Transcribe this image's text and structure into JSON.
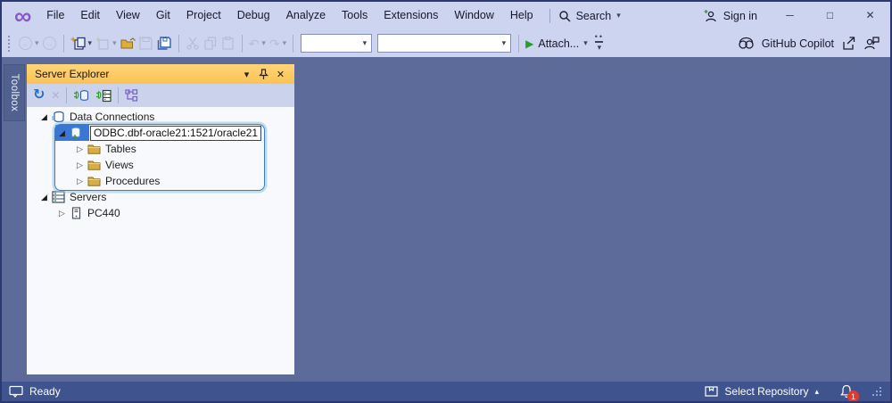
{
  "titlebar": {
    "menus": [
      "File",
      "Edit",
      "View",
      "Git",
      "Project",
      "Debug",
      "Analyze",
      "Tools",
      "Extensions",
      "Window",
      "Help"
    ],
    "search_label": "Search",
    "sign_in_label": "Sign in"
  },
  "toolbar": {
    "attach_label": "Attach...",
    "copilot_label": "GitHub Copilot"
  },
  "left_dock": {
    "toolbox_label": "Toolbox"
  },
  "server_explorer": {
    "title": "Server Explorer",
    "tree": [
      {
        "label": "Data Connections"
      },
      {
        "label": "ODBC.dbf-oracle21:1521/oracle21"
      },
      {
        "label": "Tables"
      },
      {
        "label": "Views"
      },
      {
        "label": "Procedures"
      },
      {
        "label": "Servers"
      },
      {
        "label": "PC440"
      }
    ]
  },
  "statusbar": {
    "ready_label": "Ready",
    "select_repository_label": "Select Repository",
    "notification_count": "1"
  },
  "icons": {
    "vs_logo": "∞",
    "back": "←",
    "forward": "→",
    "undo": "↶",
    "redo": "↷",
    "refresh": "↻",
    "delete": "✕",
    "play": "▶",
    "caret_down": "▾",
    "caret_up": "▴",
    "minimize": "─",
    "maximize": "□",
    "close": "✕",
    "overflow_dots": "••",
    "tree_expanded": "◢",
    "tree_collapsed": "▷"
  },
  "colors": {
    "accent_purple": "#8A57C9",
    "titlebar_bg": "#CDD4F0",
    "main_bg": "#5C6B99",
    "statusbar_bg": "#3F538E",
    "panel_title_bg": "#FBC254",
    "selection_blue": "#3977D4",
    "run_green": "#23A123",
    "notification_red": "#E03A2F"
  }
}
